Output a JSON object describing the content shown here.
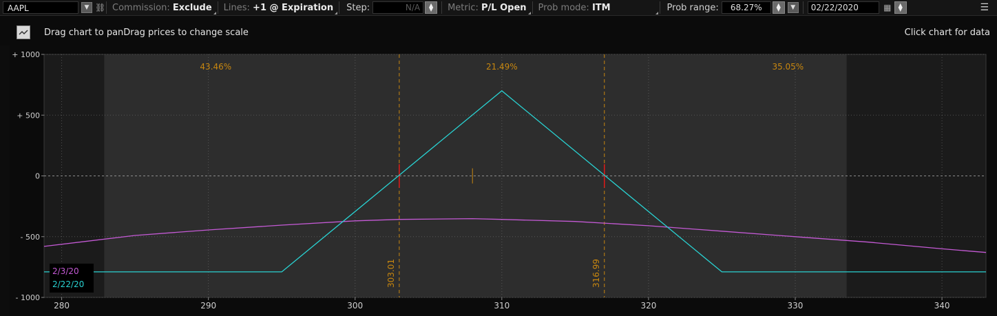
{
  "toolbar": {
    "symbol": "AAPL",
    "commission_label": "Commission:",
    "commission_value": "Exclude",
    "lines_label": "Lines:",
    "lines_value": "+1 @ Expiration",
    "step_label": "Step:",
    "step_value": "N/A",
    "metric_label": "Metric:",
    "metric_value": "P/L Open",
    "prob_mode_label": "Prob mode:",
    "prob_mode_value": "ITM",
    "prob_range_label": "Prob range:",
    "prob_range_value": "68.27%",
    "date_value": "02/22/2020"
  },
  "info": {
    "left_text": "Drag chart to panDrag prices to change scale",
    "right_text": "Click chart for data"
  },
  "colors": {
    "cyan": "#29d3d3",
    "magenta": "#c55ad6",
    "orange": "#c8870f",
    "red": "#e01919",
    "plot_bg": "#2d2d2d",
    "outer_bg": "#1b1b1b"
  },
  "chart_data": {
    "type": "line",
    "xlim": [
      278.8,
      343
    ],
    "ylim": [
      -1000,
      1000
    ],
    "x_ticks": [
      280,
      290,
      300,
      310,
      320,
      330,
      340
    ],
    "y_ticks": [
      {
        "value": 1000,
        "label": "+ 1000"
      },
      {
        "value": 500,
        "label": "+ 500"
      },
      {
        "value": 0,
        "label": "0"
      },
      {
        "value": -500,
        "label": "- 500"
      },
      {
        "value": -1000,
        "label": "- 1000"
      }
    ],
    "grid": true,
    "probability_range": [
      282.9,
      333.5
    ],
    "probabilities": [
      {
        "label": "43.46%",
        "x": 290.5
      },
      {
        "label": "21.49%",
        "x": 310
      },
      {
        "label": "35.05%",
        "x": 329.5
      }
    ],
    "breakevens": [
      {
        "x": 303.01,
        "label": "303.01"
      },
      {
        "x": 316.99,
        "label": "316.99"
      }
    ],
    "current_price": 308,
    "series": [
      {
        "name": "2/3/20",
        "color": "#c55ad6",
        "points": [
          [
            278.8,
            -580
          ],
          [
            285,
            -490
          ],
          [
            290,
            -445
          ],
          [
            295,
            -405
          ],
          [
            300,
            -370
          ],
          [
            303,
            -358
          ],
          [
            308,
            -352
          ],
          [
            310,
            -358
          ],
          [
            315,
            -375
          ],
          [
            320,
            -410
          ],
          [
            325,
            -455
          ],
          [
            330,
            -500
          ],
          [
            335,
            -545
          ],
          [
            340,
            -600
          ],
          [
            343,
            -630
          ]
        ]
      },
      {
        "name": "2/22/20",
        "color": "#29d3d3",
        "points": [
          [
            278.8,
            -790
          ],
          [
            295,
            -790
          ],
          [
            310,
            700
          ],
          [
            325,
            -790
          ],
          [
            343,
            -790
          ]
        ]
      }
    ],
    "legend": "bottom-left"
  }
}
